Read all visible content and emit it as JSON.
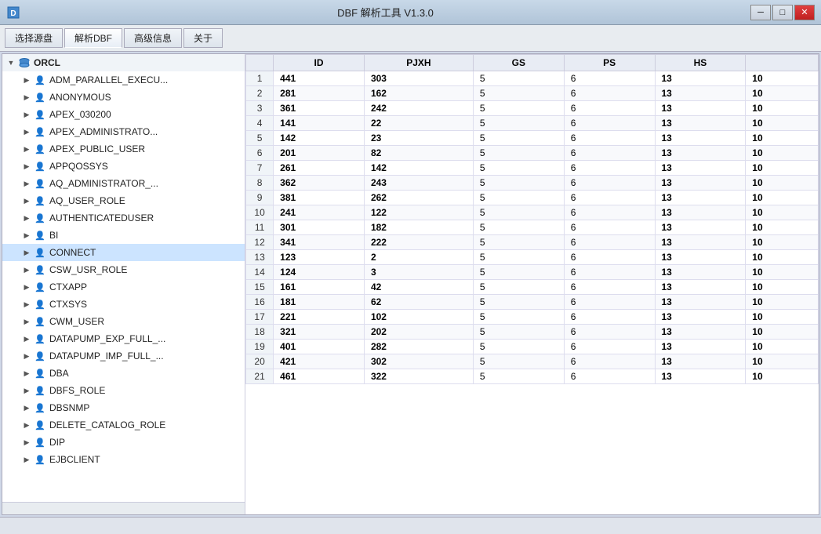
{
  "window": {
    "title": "DBF 解析工具 V1.3.0",
    "minimize_label": "─",
    "restore_label": "□",
    "close_label": "✕"
  },
  "menu": {
    "tabs": [
      {
        "id": "choose-source",
        "label": "选择源盘"
      },
      {
        "id": "parse-dbf",
        "label": "解析DBF",
        "active": true
      },
      {
        "id": "advanced-info",
        "label": "高级信息"
      },
      {
        "id": "about",
        "label": "关于"
      }
    ]
  },
  "tree": {
    "root_label": "ORCL",
    "items": [
      {
        "id": "adm-parallel",
        "label": "ADM_PARALLEL_EXECU...",
        "icon": "user"
      },
      {
        "id": "anonymous",
        "label": "ANONYMOUS",
        "icon": "user"
      },
      {
        "id": "apex-030200",
        "label": "APEX_030200",
        "icon": "user"
      },
      {
        "id": "apex-admin",
        "label": "APEX_ADMINISTRATO...",
        "icon": "user"
      },
      {
        "id": "apex-public-user",
        "label": "APEX_PUBLIC_USER",
        "icon": "user"
      },
      {
        "id": "appqossys",
        "label": "APPQOSSYS",
        "icon": "user"
      },
      {
        "id": "aq-admin",
        "label": "AQ_ADMINISTRATOR_...",
        "icon": "user"
      },
      {
        "id": "aq-user-role",
        "label": "AQ_USER_ROLE",
        "icon": "user"
      },
      {
        "id": "authenticateduser",
        "label": "AUTHENTICATEDUSER",
        "icon": "user"
      },
      {
        "id": "bi",
        "label": "BI",
        "icon": "user"
      },
      {
        "id": "connect",
        "label": "CONNECT",
        "icon": "user",
        "selected": true
      },
      {
        "id": "csw-usr-role",
        "label": "CSW_USR_ROLE",
        "icon": "user"
      },
      {
        "id": "ctxapp",
        "label": "CTXAPP",
        "icon": "user"
      },
      {
        "id": "ctxsys",
        "label": "CTXSYS",
        "icon": "user"
      },
      {
        "id": "cwm-user",
        "label": "CWM_USER",
        "icon": "user"
      },
      {
        "id": "datapump-exp",
        "label": "DATAPUMP_EXP_FULL_...",
        "icon": "user"
      },
      {
        "id": "datapump-imp",
        "label": "DATAPUMP_IMP_FULL_...",
        "icon": "user"
      },
      {
        "id": "dba",
        "label": "DBA",
        "icon": "user"
      },
      {
        "id": "dbfs-role",
        "label": "DBFS_ROLE",
        "icon": "user"
      },
      {
        "id": "dbsnmp",
        "label": "DBSNMP",
        "icon": "user"
      },
      {
        "id": "delete-catalog-role",
        "label": "DELETE_CATALOG_ROLE",
        "icon": "user"
      },
      {
        "id": "dip",
        "label": "DIP",
        "icon": "user"
      },
      {
        "id": "ejbclient",
        "label": "EJBCLIENT",
        "icon": "user"
      }
    ]
  },
  "grid": {
    "columns": [
      {
        "id": "row",
        "label": ""
      },
      {
        "id": "id",
        "label": "ID"
      },
      {
        "id": "pjxh",
        "label": "PJXH"
      },
      {
        "id": "gs",
        "label": "GS"
      },
      {
        "id": "ps",
        "label": "PS"
      },
      {
        "id": "hs",
        "label": "HS"
      }
    ],
    "rows": [
      {
        "row": 1,
        "id": "441",
        "pjxh": "303",
        "gs": "5",
        "ps": "6",
        "hs": "13",
        "extra": "10"
      },
      {
        "row": 2,
        "id": "281",
        "pjxh": "162",
        "gs": "5",
        "ps": "6",
        "hs": "13",
        "extra": "10"
      },
      {
        "row": 3,
        "id": "361",
        "pjxh": "242",
        "gs": "5",
        "ps": "6",
        "hs": "13",
        "extra": "10"
      },
      {
        "row": 4,
        "id": "141",
        "pjxh": "22",
        "gs": "5",
        "ps": "6",
        "hs": "13",
        "extra": "10"
      },
      {
        "row": 5,
        "id": "142",
        "pjxh": "23",
        "gs": "5",
        "ps": "6",
        "hs": "13",
        "extra": "10"
      },
      {
        "row": 6,
        "id": "201",
        "pjxh": "82",
        "gs": "5",
        "ps": "6",
        "hs": "13",
        "extra": "10"
      },
      {
        "row": 7,
        "id": "261",
        "pjxh": "142",
        "gs": "5",
        "ps": "6",
        "hs": "13",
        "extra": "10"
      },
      {
        "row": 8,
        "id": "362",
        "pjxh": "243",
        "gs": "5",
        "ps": "6",
        "hs": "13",
        "extra": "10"
      },
      {
        "row": 9,
        "id": "381",
        "pjxh": "262",
        "gs": "5",
        "ps": "6",
        "hs": "13",
        "extra": "10"
      },
      {
        "row": 10,
        "id": "241",
        "pjxh": "122",
        "gs": "5",
        "ps": "6",
        "hs": "13",
        "extra": "10"
      },
      {
        "row": 11,
        "id": "301",
        "pjxh": "182",
        "gs": "5",
        "ps": "6",
        "hs": "13",
        "extra": "10"
      },
      {
        "row": 12,
        "id": "341",
        "pjxh": "222",
        "gs": "5",
        "ps": "6",
        "hs": "13",
        "extra": "10"
      },
      {
        "row": 13,
        "id": "123",
        "pjxh": "2",
        "gs": "5",
        "ps": "6",
        "hs": "13",
        "extra": "10"
      },
      {
        "row": 14,
        "id": "124",
        "pjxh": "3",
        "gs": "5",
        "ps": "6",
        "hs": "13",
        "extra": "10"
      },
      {
        "row": 15,
        "id": "161",
        "pjxh": "42",
        "gs": "5",
        "ps": "6",
        "hs": "13",
        "extra": "10"
      },
      {
        "row": 16,
        "id": "181",
        "pjxh": "62",
        "gs": "5",
        "ps": "6",
        "hs": "13",
        "extra": "10"
      },
      {
        "row": 17,
        "id": "221",
        "pjxh": "102",
        "gs": "5",
        "ps": "6",
        "hs": "13",
        "extra": "10"
      },
      {
        "row": 18,
        "id": "321",
        "pjxh": "202",
        "gs": "5",
        "ps": "6",
        "hs": "13",
        "extra": "10"
      },
      {
        "row": 19,
        "id": "401",
        "pjxh": "282",
        "gs": "5",
        "ps": "6",
        "hs": "13",
        "extra": "10"
      },
      {
        "row": 20,
        "id": "421",
        "pjxh": "302",
        "gs": "5",
        "ps": "6",
        "hs": "13",
        "extra": "10"
      },
      {
        "row": 21,
        "id": "461",
        "pjxh": "322",
        "gs": "5",
        "ps": "6",
        "hs": "13",
        "extra": "10"
      }
    ]
  },
  "status_bar": {
    "text": ""
  }
}
